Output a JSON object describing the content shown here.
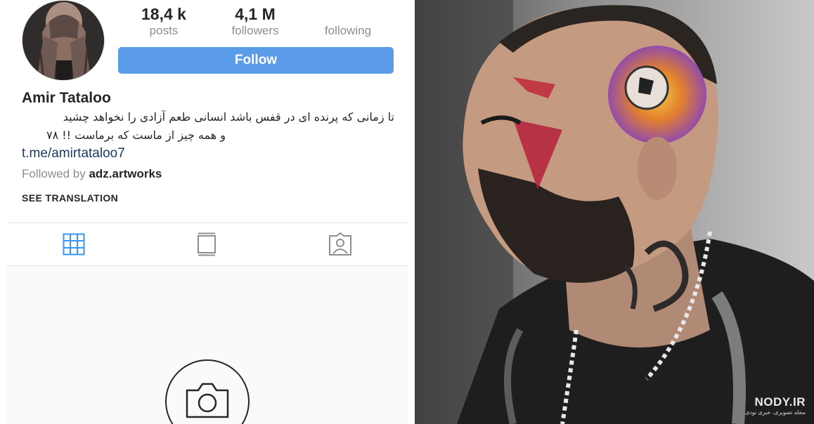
{
  "profile": {
    "name": "Amir Tataloo",
    "bio_line1": "تا زمانی که پرنده ای در قفس باشد انسانی طعم آزادی را نخواهد چشید",
    "bio_line2": "و همه چیز از ماست که برماست !! ۷۸",
    "link": "t.me/amirtataloo7",
    "followed_by_prefix": "Followed by ",
    "followed_by_user": "adz.artworks",
    "see_translation": "SEE TRANSLATION"
  },
  "stats": {
    "posts_value": "18,4 k",
    "posts_label": "posts",
    "followers_value": "4,1 M",
    "followers_label": "followers",
    "following_label": "following"
  },
  "actions": {
    "follow_label": "Follow"
  },
  "tabs": [
    {
      "icon": "grid-icon",
      "active": true
    },
    {
      "icon": "feed-icon",
      "active": false
    },
    {
      "icon": "tagged-icon",
      "active": false
    }
  ],
  "watermark": {
    "main": "NODY.IR",
    "sub": "مجله تصویری، خبری نودی"
  },
  "colors": {
    "follow_button": "#5b9ce8",
    "active_tab": "#3897f0",
    "link": "#1b3a66",
    "muted": "#8e8e8e"
  }
}
